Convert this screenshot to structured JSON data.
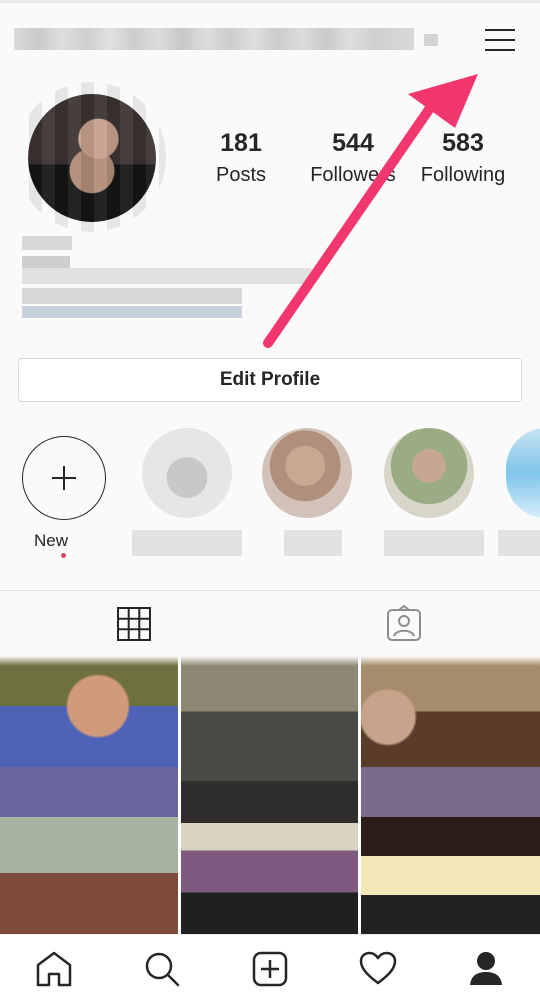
{
  "profile": {
    "stats": [
      {
        "value": "181",
        "label": "Posts"
      },
      {
        "value": "544",
        "label": "Followers"
      },
      {
        "value": "583",
        "label": "Following"
      }
    ]
  },
  "actions": {
    "edit_profile_label": "Edit Profile"
  },
  "highlights": {
    "new_label": "New"
  },
  "icons": {
    "menu": "hamburger-menu-icon",
    "new_story": "plus-icon",
    "tab_grid": "grid-icon",
    "tab_tagged": "tagged-person-icon",
    "nav": [
      "home-icon",
      "search-icon",
      "add-post-icon",
      "heart-icon",
      "profile-icon"
    ]
  },
  "colors": {
    "annotation_arrow": "#f2376f",
    "new_dot": "#d8455e",
    "text": "#262626"
  }
}
